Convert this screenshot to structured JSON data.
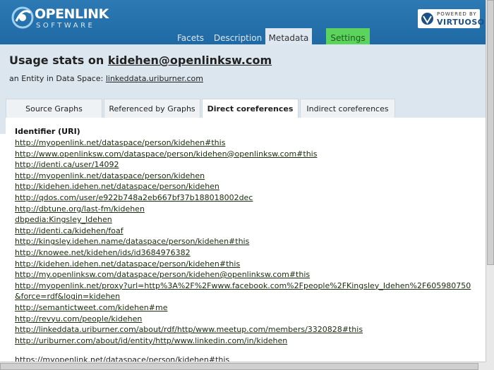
{
  "header": {
    "logo_main": "OPENLINK",
    "logo_sub": "SOFTWARE",
    "virtuoso_powered": "POWERED BY",
    "virtuoso_name": "VIRTUOSO",
    "tabs": [
      "Facets",
      "Description",
      "Metadata",
      "Settings"
    ]
  },
  "page": {
    "title_prefix": "Usage stats on ",
    "title_link": "kidehen@openlinksw.com",
    "subtitle_prefix": "an Entity in Data Space: ",
    "subtitle_link": "linkeddata.uriburner.com"
  },
  "subtabs": [
    "Source Graphs",
    "Referenced by Graphs",
    "Direct coreferences",
    "Indirect coreferences"
  ],
  "content": {
    "heading": "Identifier (URI)",
    "links": [
      "http://myopenlink.net/dataspace/person/kidehen#this",
      "http://www.openlinksw.com/dataspace/person/kidehen@openlinksw.com#this",
      "http://identi.ca/user/14092",
      "http://myopenlink.net/dataspace/person/kidehen",
      "http://kidehen.idehen.net/dataspace/person/kidehen",
      "http://qdos.com/user/e922b748a2eb667bf37b188018002dec",
      "http://dbtune.org/last-fm/kidehen",
      "dbpedia:Kingsley_Idehen",
      "http://identi.ca/kidehen/foaf",
      "http://kingsley.idehen.name/dataspace/person/kidehen#this",
      "http://knowee.net/kidehen/ids/id3684976382",
      "http://kidehen.idehen.net/dataspace/person/kidehen#this",
      "http://my.openlinksw.com/dataspace/person/kidehen@openlinksw.com#this",
      "http://myopenlink.net/proxy?url=http%3A%2F%2Fwww.facebook.com%2Fpeople%2FKingsley_Idehen%2F605980750&force=rdf&login=kidehen",
      "http://semantictweet.com/kidehen#me",
      "http://revyu.com/people/kidehen",
      "http://linkeddata.uriburner.com/about/rdf/http/www.meetup.com/members/3320828#this",
      "http://uriburner.com/about/id/entity/http/www.linkedin.com/in/kidehen"
    ],
    "trailing": "https://myopenlink.net/dataspace/person/kidehen#this"
  }
}
